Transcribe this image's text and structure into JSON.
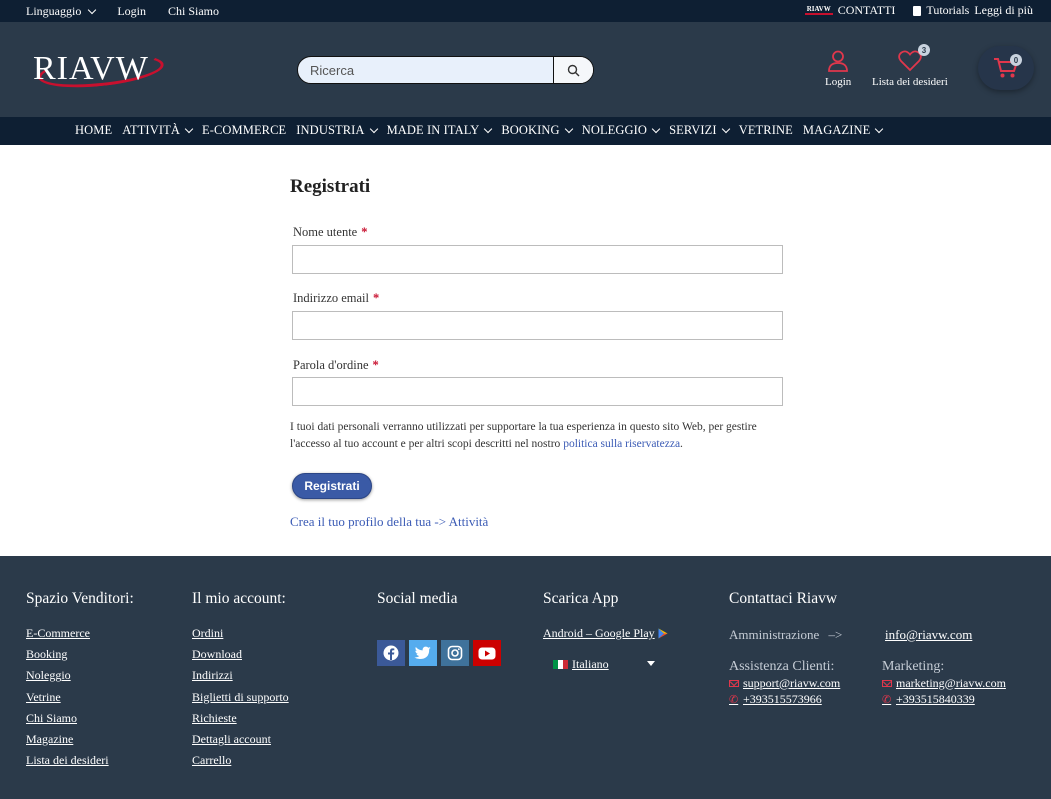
{
  "topbar": {
    "language": "Linguaggio",
    "login": "Login",
    "about": "Chi Siamo",
    "contacts": "CONTATTI",
    "tutorials": "Tutorials",
    "read_more": "Leggi di più",
    "mini_logo": "RIAVW"
  },
  "header": {
    "logo_text": "RIAVW",
    "search_placeholder": "Ricerca",
    "login_label": "Login",
    "wishlist_label": "Lista dei desideri",
    "wishlist_count": "3",
    "cart_count": "0",
    "accent_color": "#c8102e"
  },
  "nav": {
    "items": [
      {
        "label": "HOME",
        "dropdown": false
      },
      {
        "label": "ATTIVITÀ",
        "dropdown": true
      },
      {
        "label": "E-COMMERCE",
        "dropdown": false
      },
      {
        "label": "INDUSTRIA",
        "dropdown": true
      },
      {
        "label": "MADE IN ITALY",
        "dropdown": true
      },
      {
        "label": "BOOKING",
        "dropdown": true
      },
      {
        "label": "NOLEGGIO",
        "dropdown": true
      },
      {
        "label": "SERVIZI",
        "dropdown": true
      },
      {
        "label": "VETRINE",
        "dropdown": false
      },
      {
        "label": "MAGAZINE",
        "dropdown": true
      }
    ]
  },
  "form": {
    "title": "Registrati",
    "username_label": "Nome utente",
    "email_label": "Indirizzo email",
    "password_label": "Parola d'ordine",
    "required_mark": "*",
    "privacy_text": "I tuoi dati personali verranno utilizzati per supportare la tua esperienza in questo sito Web, per gestire l'accesso al tuo account e per altri scopi descritti nel nostro ",
    "privacy_link": "politica sulla riservatezza",
    "privacy_end": ".",
    "submit_label": "Registrati",
    "profile_link": "Crea il tuo profilo della tua -> Attività"
  },
  "footer": {
    "vendors": {
      "title": "Spazio Venditori:",
      "items": [
        "E-Commerce",
        "Booking",
        "Noleggio",
        "Vetrine",
        "Chi Siamo",
        "Magazine",
        "Lista dei desideri"
      ]
    },
    "account": {
      "title": "Il mio account:",
      "items": [
        "Ordini",
        "Download",
        "Indirizzi",
        "Biglietti di supporto",
        "Richieste",
        "Dettagli account",
        "Carrello"
      ]
    },
    "social": {
      "title": "Social media",
      "icons": [
        "facebook-icon",
        "twitter-icon",
        "instagram-icon",
        "youtube-icon"
      ]
    },
    "app": {
      "title": "Scarica App",
      "android": "Android – Google Play",
      "language": "Italiano"
    },
    "contact": {
      "title": "Contattaci Riavw",
      "admin_label": "Amministrazione",
      "admin_arrow": "–>",
      "admin_email": "info@riavw.com",
      "support_label": "Assistenza Clienti:",
      "support_email": "support@riavw.com",
      "support_phone": "+393515573966",
      "marketing_label": "Marketing:",
      "marketing_email": "marketing@riavw.com",
      "marketing_phone": "+393515840339"
    }
  }
}
